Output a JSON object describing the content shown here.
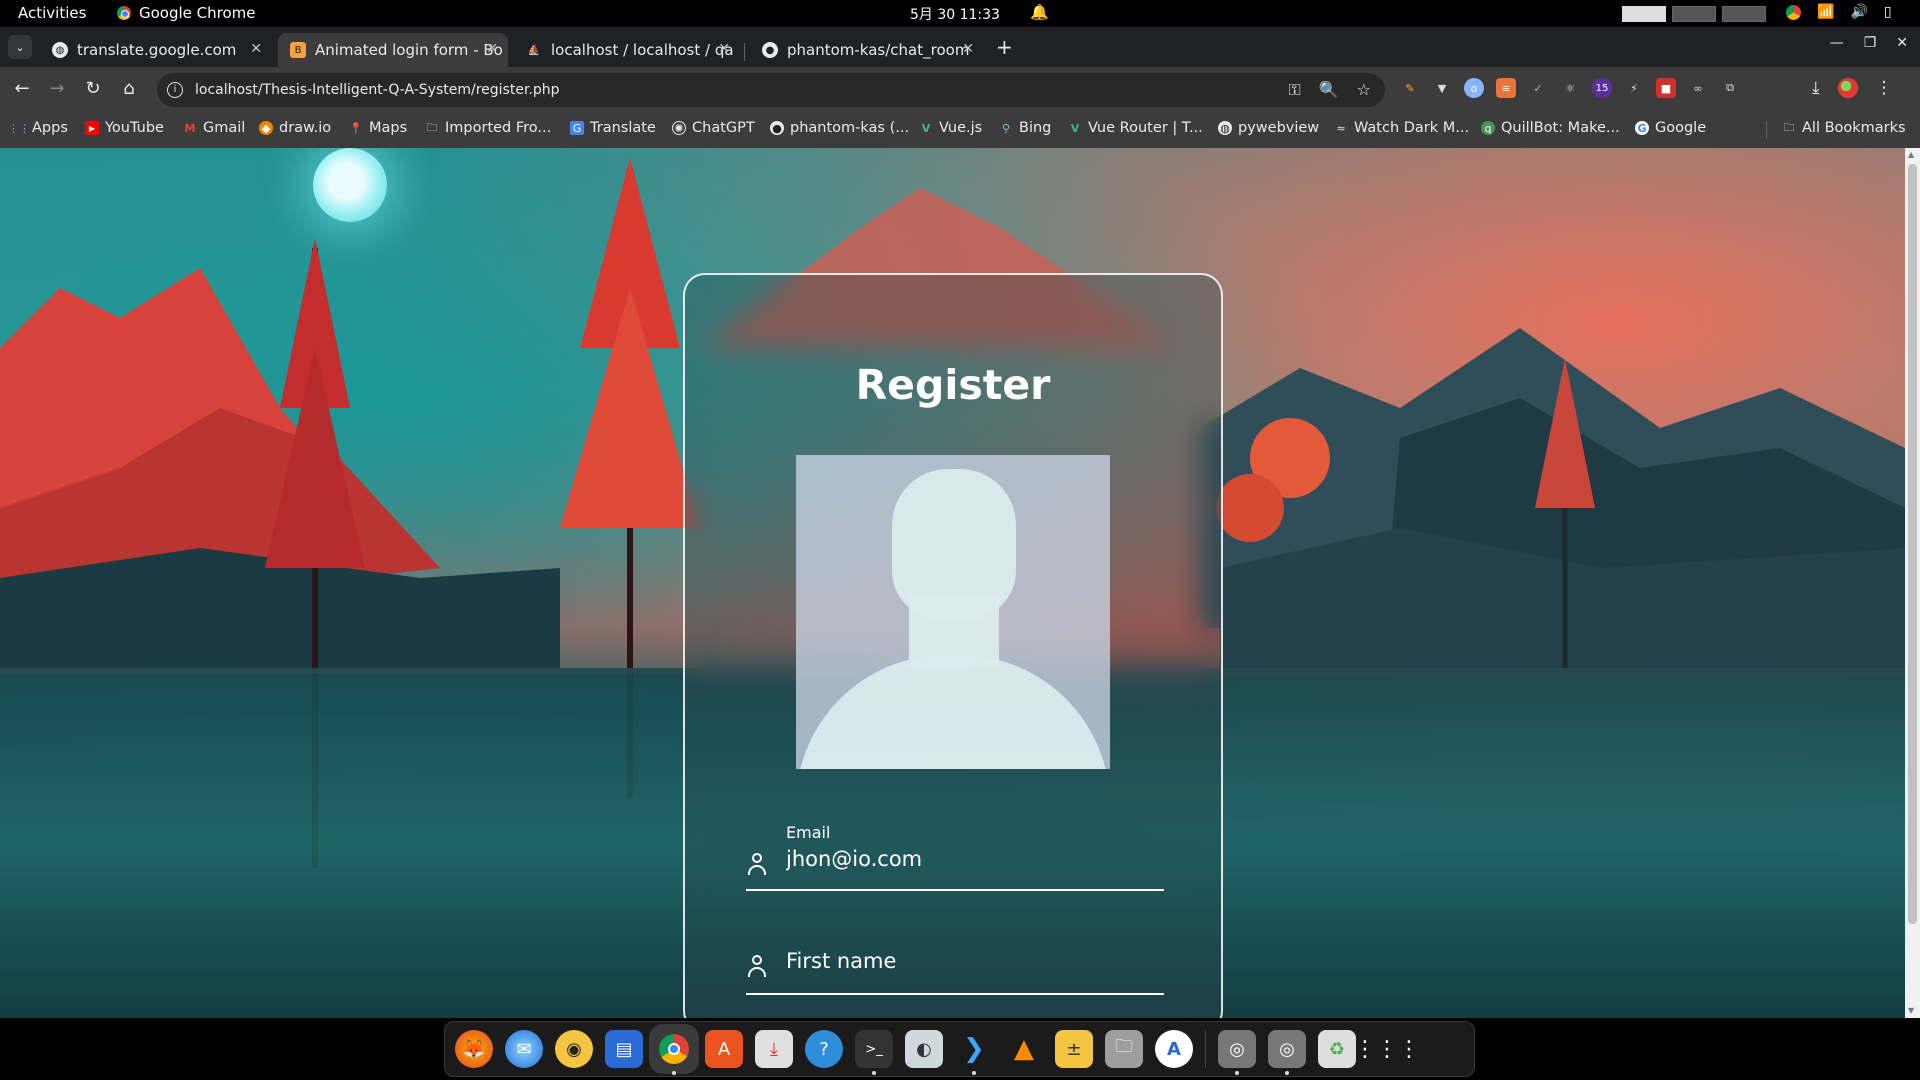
{
  "topbar": {
    "activities": "Activities",
    "app_name": "Google Chrome",
    "clock": "5月 30  11:33"
  },
  "tabs": [
    {
      "title": "translate.google.com",
      "favicon": "globe-icon",
      "active": false
    },
    {
      "title": "Animated login form - Bo",
      "favicon": "codepen-icon",
      "active": true
    },
    {
      "title": "localhost / localhost / qa",
      "favicon": "phpmyadmin-icon",
      "active": false
    },
    {
      "title": "phantom-kas/chat_room",
      "favicon": "github-icon",
      "active": false
    }
  ],
  "toolbar": {
    "url": "localhost/Thesis-Intelligent-Q-A-System/register.php",
    "extension_badge": "15"
  },
  "bookmarks": [
    {
      "label": "Apps",
      "icon": "apps-grid-icon"
    },
    {
      "label": "YouTube",
      "icon": "youtube-icon"
    },
    {
      "label": "Gmail",
      "icon": "gmail-icon"
    },
    {
      "label": "draw.io",
      "icon": "drawio-icon"
    },
    {
      "label": "Maps",
      "icon": "maps-icon"
    },
    {
      "label": "Imported Fro...",
      "icon": "folder-icon"
    },
    {
      "label": "Translate",
      "icon": "translate-icon"
    },
    {
      "label": "ChatGPT",
      "icon": "chatgpt-icon"
    },
    {
      "label": "phantom-kas (...",
      "icon": "github-icon"
    },
    {
      "label": "Vue.js",
      "icon": "vue-icon"
    },
    {
      "label": "Bing",
      "icon": "search-icon"
    },
    {
      "label": "Vue Router | T...",
      "icon": "vue-icon"
    },
    {
      "label": "pywebview",
      "icon": "globe-icon"
    },
    {
      "label": "Watch Dark M...",
      "icon": "wifi-icon"
    },
    {
      "label": "QuillBot: Make...",
      "icon": "quillbot-icon"
    },
    {
      "label": "Google",
      "icon": "google-icon"
    }
  ],
  "all_bookmarks": "All Bookmarks",
  "page": {
    "title": "Register",
    "email_label": "Email",
    "email_value": "jhon@io.com",
    "first_name_placeholder": "First name"
  },
  "colors": {
    "card_border": "#ffffff",
    "chrome_dark": "#202124",
    "toolbar_bg": "#3c3c3c"
  }
}
